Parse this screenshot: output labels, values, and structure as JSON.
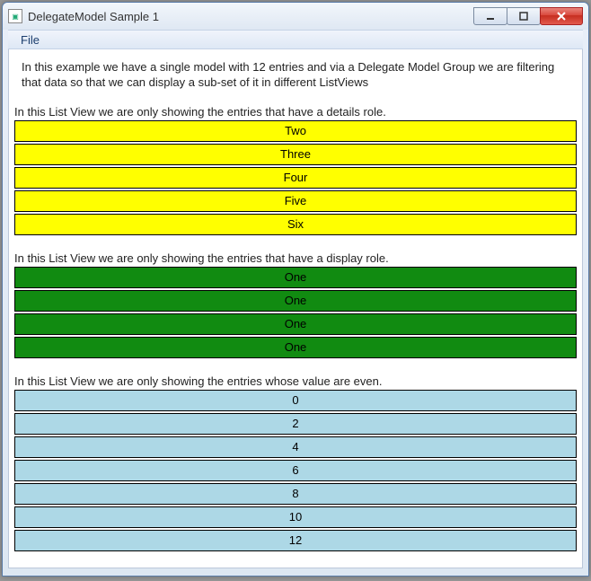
{
  "window": {
    "title": "DelegateModel Sample 1"
  },
  "menu": {
    "file": "File"
  },
  "intro": "In this example we have a single model with 12 entries and via a Delegate Model Group we are filtering that data so that we can display a sub-set of it in different ListViews",
  "section1": {
    "label": "In this List View we are only showing the entries that have a details role.",
    "items": [
      "Two",
      "Three",
      "Four",
      "Five",
      "Six"
    ]
  },
  "section2": {
    "label": "In this List View we are only showing the entries that have a display role.",
    "items": [
      "One",
      "One",
      "One",
      "One"
    ]
  },
  "section3": {
    "label": "In this List View we are only showing the entries whose value are even.",
    "items": [
      "0",
      "2",
      "4",
      "6",
      "8",
      "10",
      "12"
    ]
  }
}
